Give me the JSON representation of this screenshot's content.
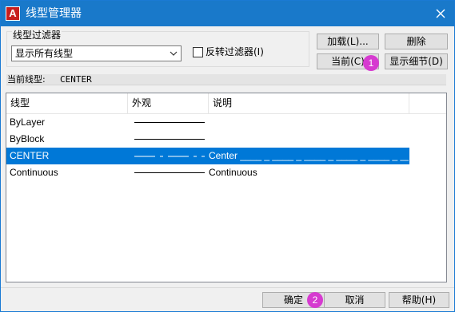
{
  "window": {
    "title": "线型管理器",
    "app_icon_letter": "A"
  },
  "filter": {
    "group_label": "线型过滤器",
    "select_value": "显示所有线型",
    "invert_label": "反转过滤器(I)"
  },
  "buttons": {
    "load": "加载(L)...",
    "delete": "删除",
    "current": "当前(C)",
    "show_details": "显示细节(D)",
    "ok": "确定",
    "cancel": "取消",
    "help": "帮助(H)"
  },
  "current_linetype": {
    "label": "当前线型:",
    "value": "CENTER"
  },
  "table": {
    "headers": [
      "线型",
      "外观",
      "说明"
    ],
    "rows": [
      {
        "name": "ByLayer",
        "description": "",
        "line_style": "solid"
      },
      {
        "name": "ByBlock",
        "description": "",
        "line_style": "solid"
      },
      {
        "name": "CENTER",
        "description": "Center ____ _ ____ _ ____ _ ____ _ ____ _ ____",
        "line_style": "center",
        "selected": true
      },
      {
        "name": "Continuous",
        "description": "Continuous",
        "line_style": "solid"
      }
    ]
  },
  "badges": {
    "one": "1",
    "two": "2"
  },
  "colors": {
    "titlebar": "#1979ca",
    "selection": "#0078d7",
    "badge": "#d63bd0"
  }
}
